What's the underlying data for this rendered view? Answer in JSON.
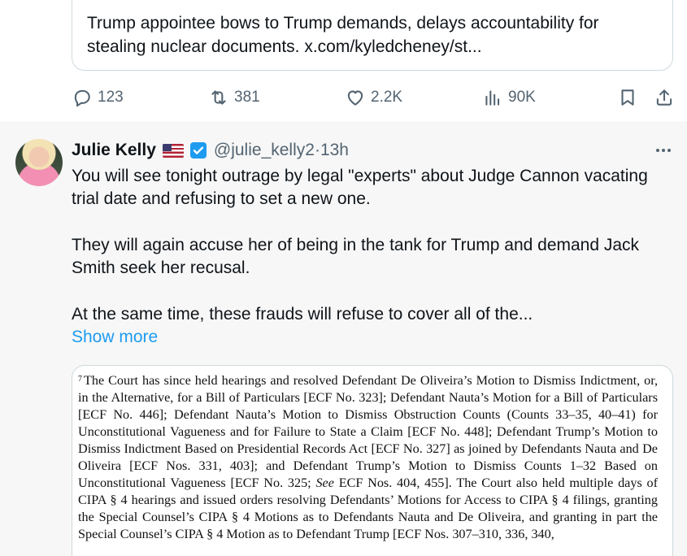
{
  "previous_tweet": {
    "quote": {
      "text": "Trump appointee bows to Trump demands, delays accountability for stealing nuclear documents. x.com/kyledcheney/st..."
    },
    "actions": {
      "replies": "123",
      "reposts": "381",
      "likes": "2.2K",
      "views": "90K"
    }
  },
  "tweet": {
    "name": "Julie Kelly",
    "flag": "🇺🇸",
    "verified_icon": "verified-badge-icon",
    "handle": "@julie_kelly2",
    "separator": " · ",
    "time": "13h",
    "paragraphs": [
      "You will see tonight outrage by legal \"experts\" about Judge Cannon vacating trial date and refusing to set a new one.",
      "They will again accuse her of being in the tank for Trump and demand Jack Smith seek her recusal.",
      "At the same time, these frauds will refuse to cover all of the..."
    ],
    "show_more": "Show more",
    "media_document": {
      "footnote_number": "7",
      "text_before_see": "The Court has since held hearings and resolved Defendant De Oliveira’s Motion to Dismiss Indictment, or, in the Alternative, for a Bill of Particulars [ECF No. 323]; Defendant Nauta’s Motion for a Bill of Particulars [ECF No. 446]; Defendant Nauta’s Motion to Dismiss Obstruction Counts (Counts 33–35, 40–41) for Unconstitutional Vagueness and for Failure to State a Claim [ECF No. 448]; Defendant Trump’s Motion to Dismiss Indictment Based on Presidential Records Act [ECF No. 327] as joined by Defendants Nauta and De Oliveira [ECF Nos. 331, 403]; and Defendant Trump’s Motion to Dismiss Counts 1–32 Based on Unconstitutional Vagueness [ECF No. 325;",
      "see_word": "See",
      "text_after_see": "ECF Nos. 404, 455].  The Court also held multiple days of CIPA § 4 hearings and issued orders resolving Defendants’ Motions for Access to CIPA § 4 filings, granting the Special Counsel’s CIPA § 4 Motions as to Defendants Nauta and De Oliveira, and granting in part the Special Counsel’s CIPA § 4 Motion as to Defendant Trump [ECF Nos. 307–310, 336, 340,"
    }
  },
  "colors": {
    "text": "#0f1419",
    "secondary": "#536471",
    "link": "#1d9bf0",
    "border": "#cfd9de",
    "background_highlight": "#f7f7f7"
  }
}
